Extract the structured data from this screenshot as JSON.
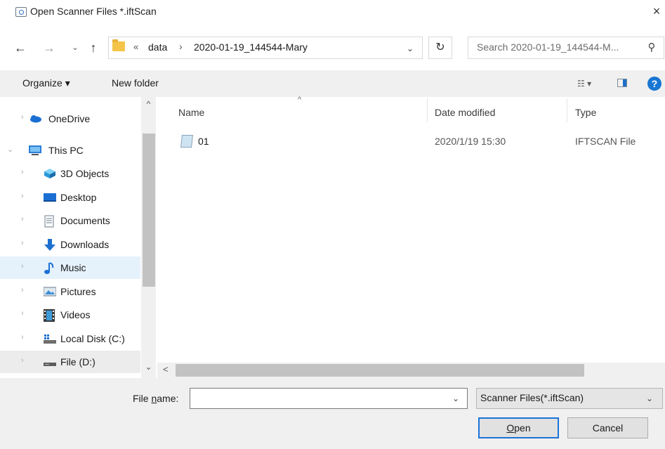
{
  "window": {
    "title": "Open Scanner Files *.iftScan",
    "close_glyph": "×",
    "title_icon": "scanner-doc-icon"
  },
  "address": {
    "back_glyph": "←",
    "forward_glyph": "→",
    "recent_glyph": "⌄",
    "up_glyph": "↑",
    "overflow": "«",
    "crumbs": [
      "data",
      "2020-01-19_144544-Mary"
    ],
    "separator": "›",
    "dropdown_glyph": "⌄",
    "refresh_glyph": "↻"
  },
  "search": {
    "placeholder": "Search 2020-01-19_144544-M...",
    "icon_glyph": "⚲"
  },
  "toolbar": {
    "organize": "Organize ▾",
    "new_folder": "New folder",
    "view_glyph": "☷ ▾",
    "help_glyph": "?"
  },
  "nav": {
    "items": [
      {
        "label": "OneDrive",
        "icon": "onedrive-icon",
        "expander": "›"
      },
      {
        "label": "This PC",
        "icon": "computer-icon",
        "expander": "⌄"
      },
      {
        "label": "3D Objects",
        "icon": "3d-objects-icon",
        "expander": "›"
      },
      {
        "label": "Desktop",
        "icon": "desktop-icon",
        "expander": "›"
      },
      {
        "label": "Documents",
        "icon": "documents-icon",
        "expander": "›"
      },
      {
        "label": "Downloads",
        "icon": "downloads-icon",
        "expander": "›"
      },
      {
        "label": "Music",
        "icon": "music-icon",
        "expander": "›"
      },
      {
        "label": "Pictures",
        "icon": "pictures-icon",
        "expander": "›"
      },
      {
        "label": "Videos",
        "icon": "videos-icon",
        "expander": "›"
      },
      {
        "label": "Local Disk (C:)",
        "icon": "local-disk-icon",
        "expander": "›"
      },
      {
        "label": "File (D:)",
        "icon": "drive-icon",
        "expander": "›"
      }
    ],
    "scroll_up": "^",
    "scroll_down": "⌄"
  },
  "filelist": {
    "columns": {
      "name": "Name",
      "date": "Date modified",
      "type": "Type"
    },
    "sort_glyph": "^",
    "files": [
      {
        "name": "01",
        "date": "2020/1/19 15:30",
        "type": "IFTSCAN File"
      }
    ],
    "hscroll_left": "<"
  },
  "bottom": {
    "filename_label_pre": "File ",
    "filename_label_acc": "n",
    "filename_label_post": "ame:",
    "filename_value": "",
    "dropdown_glyph": "⌄",
    "filetype": "Scanner Files(*.iftScan)",
    "open_acc": "O",
    "open_rest": "pen",
    "cancel": "Cancel"
  },
  "colors": {
    "accent": "#1a73d9",
    "selection": "#e5f1fb",
    "panel": "#f0f0f0"
  }
}
